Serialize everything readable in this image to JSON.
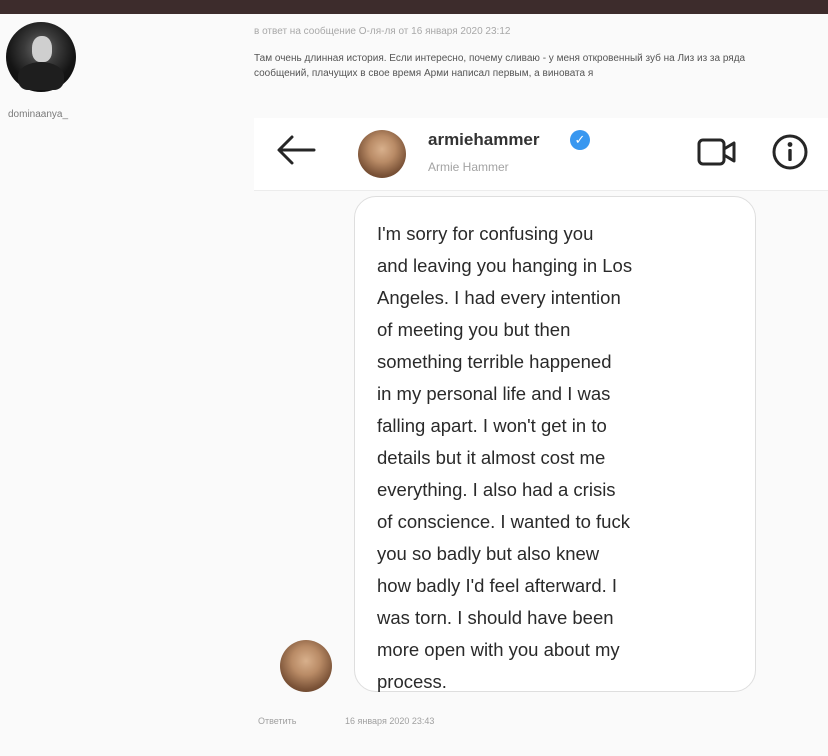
{
  "left": {
    "username": "dominaanya_"
  },
  "reply": {
    "meta": "в ответ на сообщение О-ля-ля от 16 января 2020 23:12",
    "text": "Там очень длинная история. Если интересно, почему сливаю - у меня откровенный зуб на Лиз из за ряда сообщений, плачущих в свое время Арми написал первым, а виновата я"
  },
  "header": {
    "name": "armiehammer",
    "full_name": "Armie Hammer"
  },
  "message": {
    "lines": [
      "I'm sorry for confusing you",
      "and leaving you hanging in Los",
      "Angeles. I had every intention",
      "of meeting you but then",
      "something terrible happened",
      "in my personal life and I was",
      "falling apart. I won't get in to",
      "details but it almost cost me",
      "everything. I also had a crisis",
      "of conscience. I wanted to fuck",
      "you so badly but also knew",
      "how badly I'd feel afterward. I",
      "was torn. I should have been",
      "more open with you about my",
      "process."
    ]
  },
  "footer": {
    "reply_label": "Ответить",
    "timestamp": "16 января 2020 23:43"
  },
  "colors": {
    "top_bar": "#3d2c2c",
    "verified": "#3897f0"
  },
  "icons": [
    "back-arrow-icon",
    "verified-badge-icon",
    "video-call-icon",
    "info-icon"
  ]
}
